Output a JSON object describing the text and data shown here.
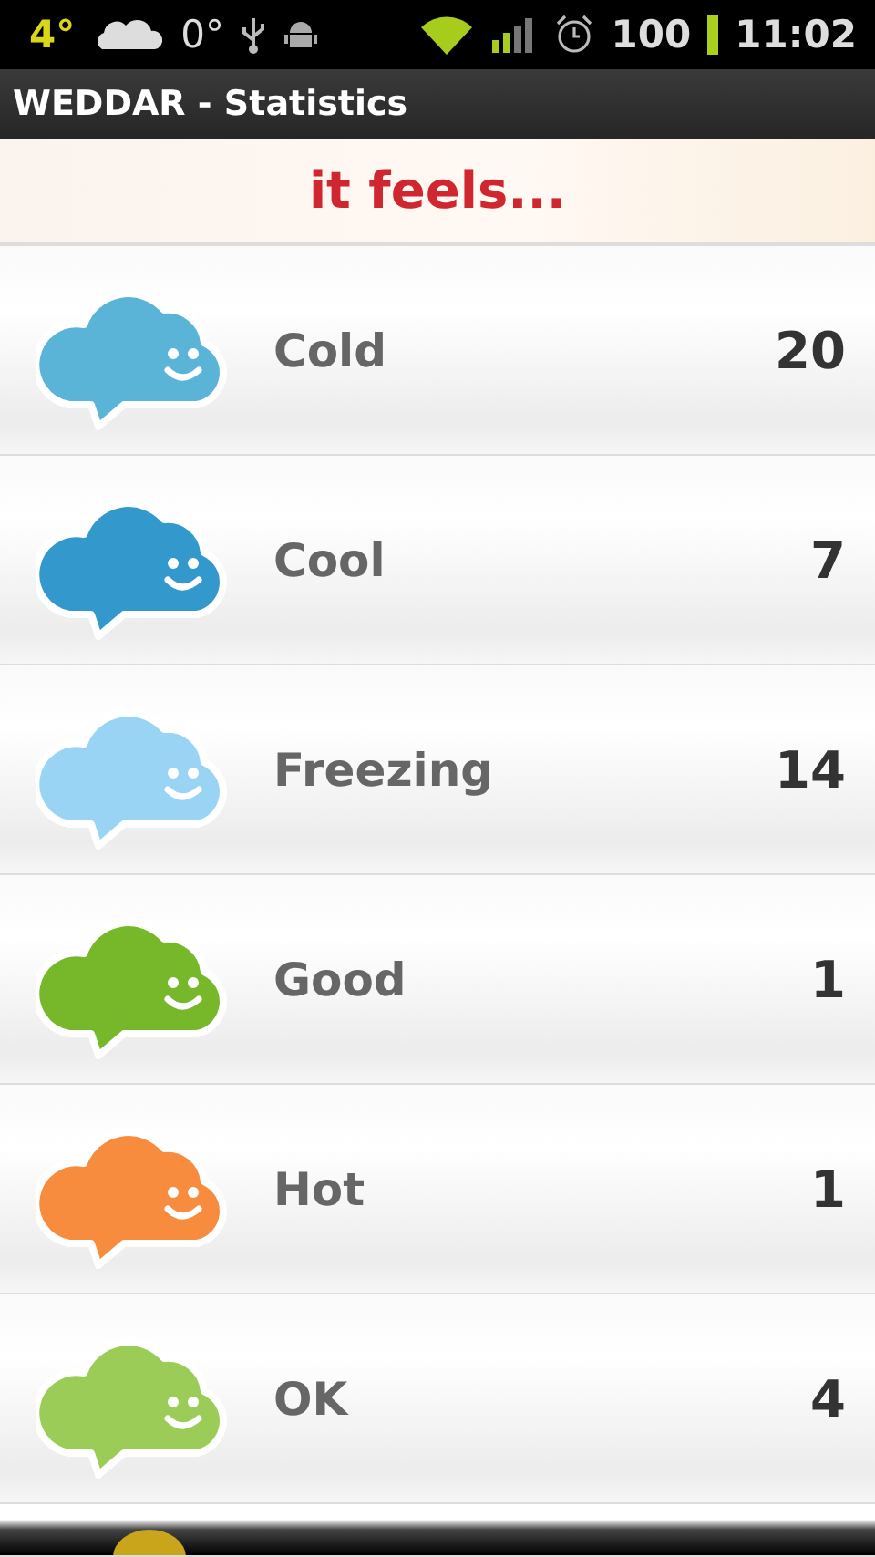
{
  "status_bar": {
    "weather_temp": "4°",
    "temp_2": "0°",
    "battery": "100",
    "time": "11:02"
  },
  "title_bar": {
    "title": "WEDDAR - Statistics"
  },
  "header": {
    "title": "it feels..."
  },
  "moods": [
    {
      "label": "Cold",
      "count": "20",
      "color": "#5ab4d8"
    },
    {
      "label": "Cool",
      "count": "7",
      "color": "#3399cc"
    },
    {
      "label": "Freezing",
      "count": "14",
      "color": "#99d4f5"
    },
    {
      "label": "Good",
      "count": "1",
      "color": "#77b82a"
    },
    {
      "label": "Hot",
      "count": "1",
      "color": "#f78c3e"
    },
    {
      "label": "OK",
      "count": "4",
      "color": "#9ccc58"
    },
    {
      "color": "#c9a51c"
    }
  ]
}
